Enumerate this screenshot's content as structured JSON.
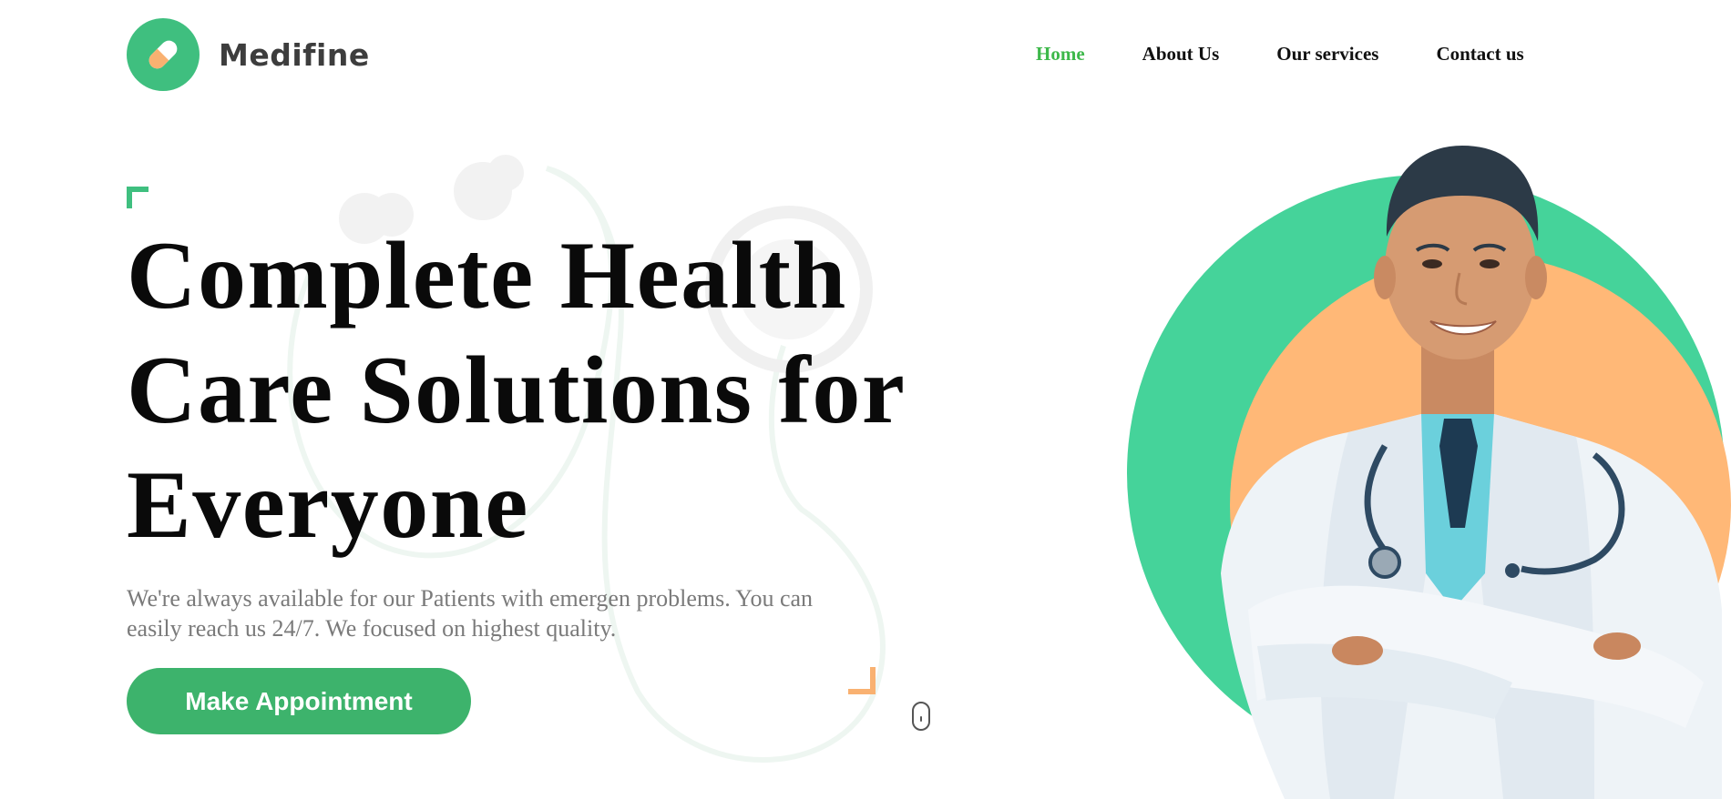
{
  "brand": {
    "name": "Medifine",
    "accent": "#3fbf7f",
    "secondary": "#f9b171"
  },
  "nav": {
    "items": [
      {
        "label": "Home",
        "active": true
      },
      {
        "label": "About Us",
        "active": false
      },
      {
        "label": "Our services",
        "active": false
      },
      {
        "label": "Contact us",
        "active": false
      }
    ]
  },
  "hero": {
    "title_lines": [
      "Complete Health",
      "Care Solutions for",
      "Everyone"
    ],
    "subtitle_lines": [
      "We're always available for our Patients with emergen problems. You can",
      "easily reach us 24/7. We focused on highest quality."
    ],
    "cta_label": "Make Appointment"
  },
  "icons": {
    "logo": "pill-icon",
    "scroll": "mouse-scroll-icon",
    "background": "stethoscope-icon"
  }
}
